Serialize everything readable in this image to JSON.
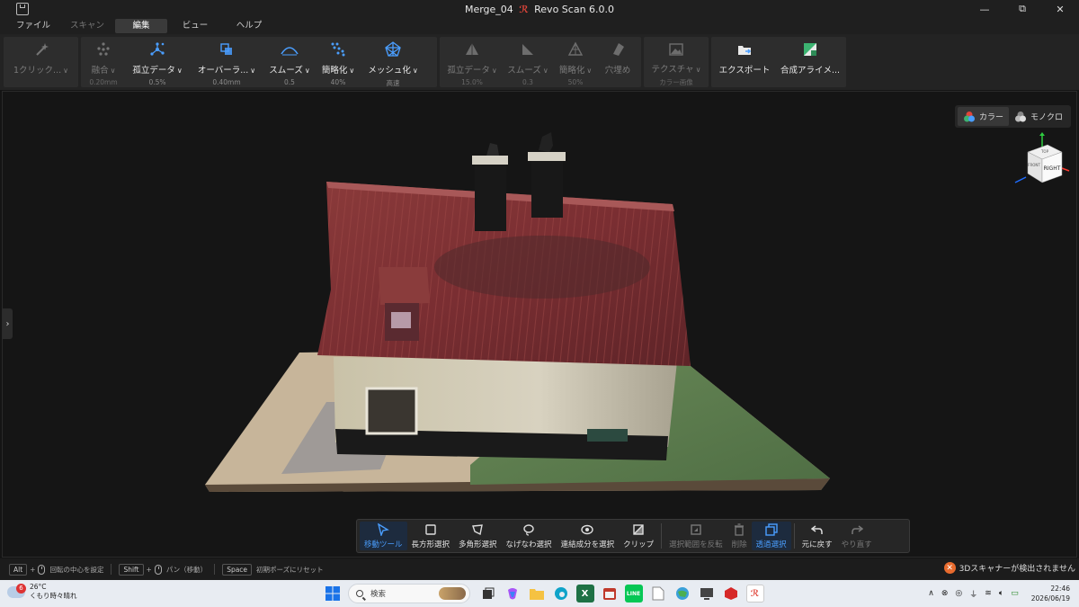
{
  "window": {
    "title_file": "Merge_04",
    "title_app": "Revo Scan 6.0.0",
    "minimize": "—",
    "maximize": "⧉",
    "close": "✕"
  },
  "menu": [
    {
      "label": "ファイル",
      "state": "normal"
    },
    {
      "label": "スキャン",
      "state": "disabled"
    },
    {
      "label": "編集",
      "state": "active"
    },
    {
      "label": "ビュー",
      "state": "normal"
    },
    {
      "label": "ヘルプ",
      "state": "normal"
    }
  ],
  "toolbar": {
    "one_click": {
      "label": "1クリック...",
      "icon": "magic-wand-icon"
    },
    "fuse": {
      "label": "融合",
      "sub": "0.20mm"
    },
    "isolate": {
      "label": "孤立データ",
      "sub": "0.5%"
    },
    "overlap": {
      "label": "オーバーラ...",
      "sub": "0.40mm"
    },
    "smooth": {
      "label": "スムーズ",
      "sub": "0.5"
    },
    "simplify": {
      "label": "簡略化",
      "sub": "40%"
    },
    "meshing": {
      "label": "メッシュ化",
      "sub": "高速"
    },
    "mesh_isolate": {
      "label": "孤立データ",
      "sub": "15.0%"
    },
    "mesh_smooth": {
      "label": "スムーズ",
      "sub": "0.3"
    },
    "mesh_simplify": {
      "label": "簡略化",
      "sub": "50%"
    },
    "fill_holes": {
      "label": "穴埋め"
    },
    "texture": {
      "label": "テクスチャ",
      "sub": "カラー画像"
    },
    "export": {
      "label": "エクスポート"
    },
    "align": {
      "label": "合成アライメ..."
    }
  },
  "viewport": {
    "color_mode": {
      "color": "カラー",
      "mono": "モノクロ",
      "selected": "color"
    },
    "view_cube": {
      "face_label": "RIGHT",
      "top_label": "TOP",
      "front_label": "FRONT"
    }
  },
  "selection_bar": {
    "move_tool": "移動ツール",
    "rect_select": "長方形選択",
    "poly_select": "多角形選択",
    "lasso_select": "なげなわ選択",
    "connected_select": "連結成分を選択",
    "clip": "クリップ",
    "invert_select": "選択範囲を反転",
    "delete": "削除",
    "through_select": "透過選択",
    "undo": "元に戻す",
    "redo": "やり直す"
  },
  "status": {
    "alt_key": "Alt",
    "alt_hint": "回転の中心を設定",
    "shift_key": "Shift",
    "shift_hint": "パン（移動）",
    "space_key": "Space",
    "space_hint": "初期ポーズにリセット",
    "scanner_message": "3Dスキャナーが検出されません"
  },
  "taskbar": {
    "weather_badge": "6",
    "temperature": "26°C",
    "weather_text": "くもり時々晴れ",
    "search_placeholder": "検索",
    "time": "22:46",
    "date": "2026/06/19"
  },
  "colors": {
    "accent_blue": "#4a9eff",
    "error_orange": "#e86b2e",
    "brand_red": "#e0453a"
  }
}
